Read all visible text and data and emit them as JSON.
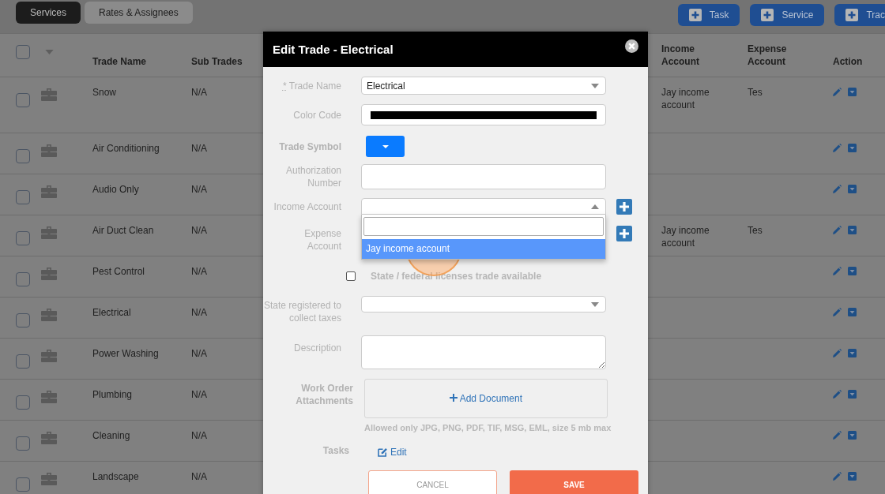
{
  "tabs": [
    {
      "label": "Services",
      "selected": true
    },
    {
      "label": "Rates & Assignees",
      "selected": false
    }
  ],
  "toolbar_buttons": [
    "Task",
    "Service",
    "Trac"
  ],
  "table": {
    "select_all_checked": false,
    "columns": [
      "Trade Name",
      "Sub Trades",
      "Income Account",
      "Expense Account",
      "Action"
    ],
    "rows": [
      {
        "checked": false,
        "trade_name": "Snow",
        "sub_trades": "N/A",
        "income_account": "Jay income account",
        "expense_account": "Tes"
      },
      {
        "checked": false,
        "trade_name": "Air Conditioning",
        "sub_trades": "N/A"
      },
      {
        "checked": false,
        "trade_name": "Audio Only",
        "sub_trades": "N/A"
      },
      {
        "checked": false,
        "trade_name": "Air Duct Clean",
        "sub_trades": "N/A",
        "income_account": "Jay income account",
        "expense_account": "Tes"
      },
      {
        "checked": false,
        "trade_name": "Pest Control",
        "sub_trades": "N/A"
      },
      {
        "checked": false,
        "trade_name": "Electrical",
        "sub_trades": "N/A"
      },
      {
        "checked": false,
        "trade_name": "Power Washing",
        "sub_trades": "N/A"
      },
      {
        "checked": false,
        "trade_name": "Plumbing",
        "sub_trades": "N/A"
      },
      {
        "checked": false,
        "trade_name": "Cleaning",
        "sub_trades": "N/A"
      },
      {
        "checked": false,
        "trade_name": "Landscape",
        "sub_trades": "N/A"
      }
    ]
  },
  "dialog": {
    "title": "Edit Trade - Electrical",
    "trade_name": {
      "required_mark": "*",
      "label": "Trade Name",
      "value": "Electrical"
    },
    "color_code": {
      "label": "Color Code",
      "color": "#000000"
    },
    "trade_symbol": {
      "label": "Trade Symbol"
    },
    "authorization_number": {
      "label": "Authorization Number"
    },
    "income_account": {
      "label": "Income Account",
      "expanded": true,
      "options": [
        {
          "label": "Jay income account",
          "selected": true
        }
      ]
    },
    "expense_account": {
      "label": "Expense Account"
    },
    "licenses": {
      "label": "State / federal licenses trade available",
      "checked": false
    },
    "state_registered": {
      "label": "State registered to collect taxes"
    },
    "description": {
      "label": "Description"
    },
    "attachments": {
      "label": "Work Order Attachments",
      "add_label": "Add Document",
      "hint": "Allowed only JPG, PNG, PDF, TIF, MSG, EML, size 5 mb max"
    },
    "tasks": {
      "label": "Tasks",
      "edit_label": "Edit"
    },
    "buttons": {
      "cancel": "CANCEL",
      "save": "SAVE"
    }
  }
}
